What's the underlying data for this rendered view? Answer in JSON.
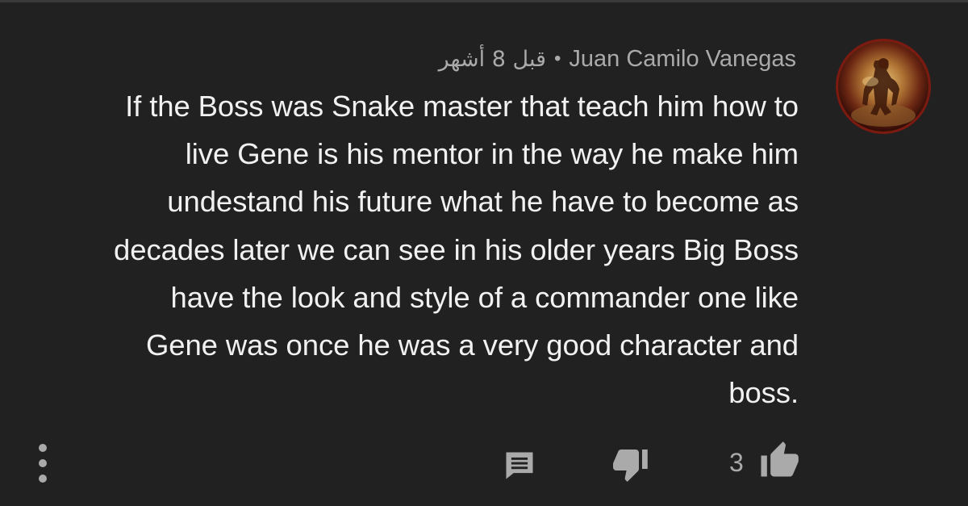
{
  "comment": {
    "author": "Juan Camilo Vanegas",
    "separator": "•",
    "time": "قبل 8 أشهر",
    "text_lines": [
      "If the Boss was Snake master that teach him how to",
      "live Gene is his mentor in the way he make him",
      "undestand his future what he have to become as",
      "decades later we can see in his older years Big Boss",
      "have the look and style of a commander one like",
      "Gene was once he was a very good character and",
      "boss."
    ],
    "like_count": "3"
  },
  "icons": {
    "more": "more-vertical-icon",
    "reply": "comment-reply-icon",
    "dislike": "thumbs-down-icon",
    "like": "thumbs-up-icon",
    "avatar": "avatar-image"
  },
  "colors": {
    "background": "#212121",
    "primary_text": "#f1f1f1",
    "secondary_text": "#aaaaaa",
    "icon": "#aaaaaa"
  }
}
